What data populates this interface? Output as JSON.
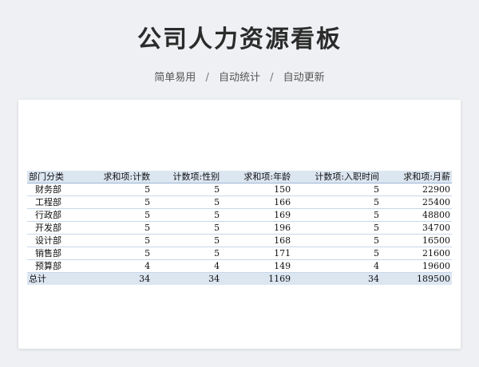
{
  "header": {
    "title": "公司人力资源看板",
    "tags": [
      "简单易用",
      "自动统计",
      "自动更新"
    ],
    "separator": "/"
  },
  "table": {
    "columns": [
      "部门分类",
      "求和项:计数",
      "计数项:性别",
      "求和项:年龄",
      "计数项:入职时间",
      "求和项:月薪"
    ],
    "rows": [
      [
        "财务部",
        "5",
        "5",
        "150",
        "5",
        "22900"
      ],
      [
        "工程部",
        "5",
        "5",
        "166",
        "5",
        "25400"
      ],
      [
        "行政部",
        "5",
        "5",
        "169",
        "5",
        "48800"
      ],
      [
        "开发部",
        "5",
        "5",
        "196",
        "5",
        "34700"
      ],
      [
        "设计部",
        "5",
        "5",
        "168",
        "5",
        "16500"
      ],
      [
        "销售部",
        "5",
        "5",
        "171",
        "5",
        "21600"
      ],
      [
        "预算部",
        "4",
        "4",
        "149",
        "4",
        "19600"
      ]
    ],
    "total": [
      "总计",
      "34",
      "34",
      "1169",
      "34",
      "189500"
    ]
  },
  "colors": {
    "header_band": "#dce6f1",
    "row_border": "#c9d7e8",
    "background": "#eef0f3"
  }
}
